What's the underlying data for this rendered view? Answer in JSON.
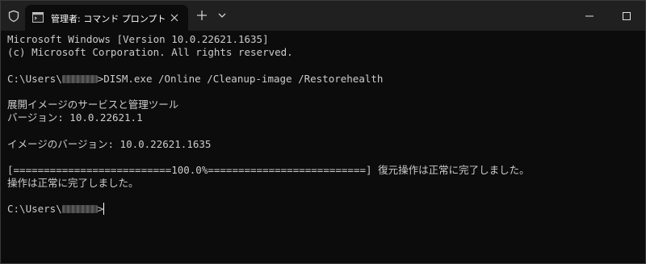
{
  "window": {
    "tab_title": "管理者: コマンド プロンプト",
    "icons": {
      "shield": "shield-icon",
      "tab": "terminal-icon",
      "tab_close": "close-icon",
      "new_tab": "plus-icon",
      "dropdown": "chevron-down-icon",
      "minimize": "minimize-icon",
      "maximize": "maximize-icon",
      "close": "close-icon"
    }
  },
  "terminal": {
    "header1": "Microsoft Windows [Version 10.0.22621.1635]",
    "header2": "(c) Microsoft Corporation. All rights reserved.",
    "prompt_prefix": "C:\\Users\\",
    "command": ">DISM.exe /Online /Cleanup-image /Restorehealth",
    "tool_name": "展開イメージのサービスと管理ツール",
    "tool_version": "バージョン: 10.0.22621.1",
    "image_version": "イメージのバージョン: 10.0.22621.1635",
    "progress_line": "[==========================100.0%==========================] 復元操作は正常に完了しました。",
    "result": "操作は正常に完了しました。",
    "final_prompt_suffix": ">"
  },
  "colors": {
    "background": "#0c0c0c",
    "text": "#cccccc",
    "titlebar": "#202020"
  }
}
